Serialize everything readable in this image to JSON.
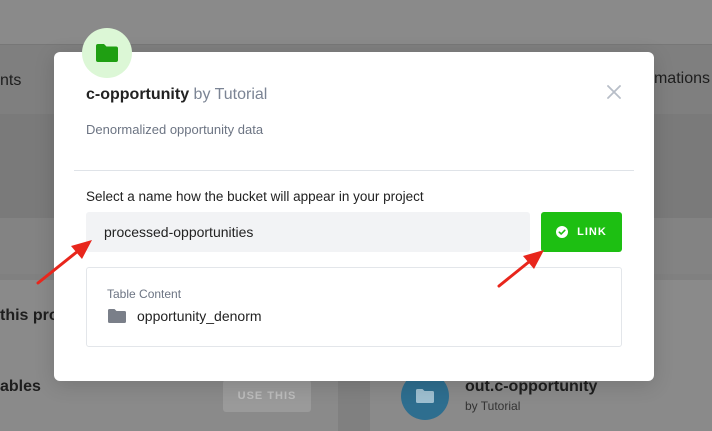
{
  "background": {
    "tab_left_fragment": "nts",
    "tab_right_fragment": "mations",
    "card_left_title_fragment": "this proj",
    "card_left_subtitle_fragment": "ables",
    "use_button_label": "USE THIS",
    "bucket_card": {
      "name": "out.c-opportunity",
      "owner": "by Tutorial",
      "icon": "folder-icon"
    }
  },
  "modal": {
    "badge_icon": "folder-icon",
    "title": {
      "name": "c-opportunity",
      "by": "by Tutorial"
    },
    "close_icon": "close-icon",
    "description": "Denormalized opportunity data",
    "field_label": "Select a name how the bucket will appear in your project",
    "name_input": {
      "value": "processed-opportunities"
    },
    "link_button": {
      "label": "LINK",
      "icon": "check-circle-icon"
    },
    "table_content": {
      "title": "Table Content",
      "items": [
        {
          "label": "opportunity_denorm",
          "icon": "folder-icon"
        }
      ]
    }
  },
  "colors": {
    "accent_green": "#1dbf12",
    "badge_bg": "#dcf7d6",
    "annotation_red": "#e8261c"
  }
}
